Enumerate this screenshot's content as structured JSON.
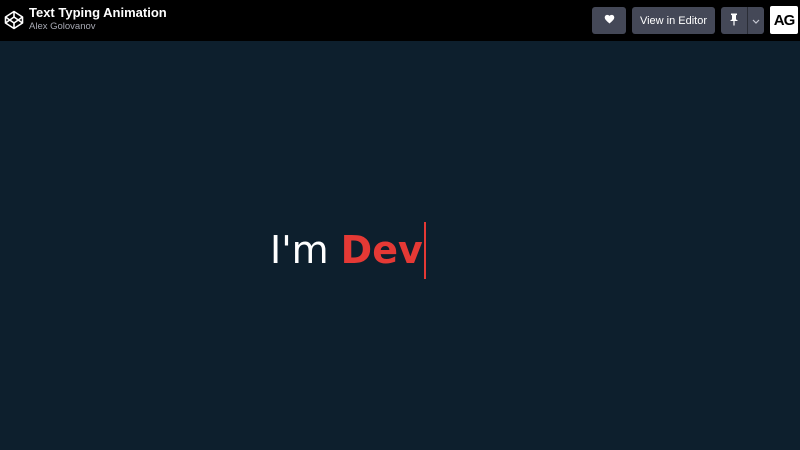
{
  "header": {
    "title": "Text Typing Animation",
    "author": "Alex Golovanov",
    "logo_icon": "codepen-logo-icon",
    "buttons": {
      "heart_icon": "heart-icon",
      "view_in_editor": "View in Editor",
      "pin_icon": "pin-icon",
      "dropdown_icon": "chevron-down-icon"
    },
    "avatar_initials": "AG"
  },
  "main": {
    "static_text": "I'm",
    "typed_text": "Dev"
  },
  "colors": {
    "background": "#0d1f2d",
    "topbar": "#000000",
    "button": "#444857",
    "accent": "#e53935",
    "text": "#ffffff"
  }
}
